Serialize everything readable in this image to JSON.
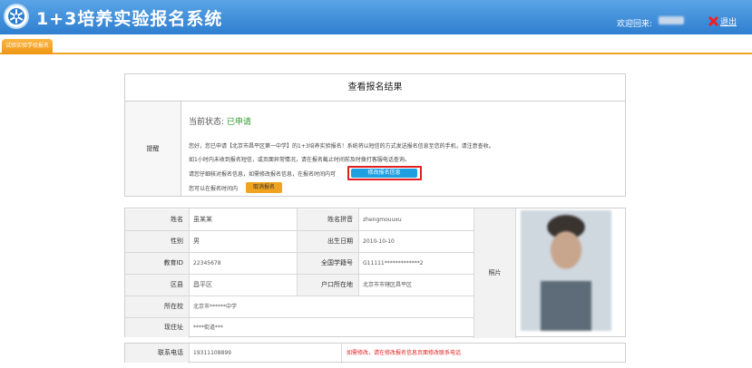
{
  "header": {
    "title": "1+3培养实验报名系统",
    "welcome": "欢迎回来:",
    "logout": "退出"
  },
  "tabs": [
    {
      "label": "试验实验学校报名"
    }
  ],
  "result": {
    "title": "查看报名结果",
    "hint_label": "提醒",
    "status_prefix": "当前状态:",
    "status_value": "已申请",
    "lines": [
      "您好，您已申请【北京市昌平区第一中学】的1+3培养实验报名！系统将以短信的方式发送报名信息至您的手机，请注意查收。",
      "如1小时内未收到报名短信，或页面异常情况，请在报名截止时间前及时拨打客服电话查询。",
      "请您仔细核对报名信息，如需修改报名信息，在报名时间内可",
      "您可以在报名时间内"
    ],
    "modify_button": "修改报名信息",
    "cancel_button": "取消报名"
  },
  "info": {
    "rows": [
      {
        "label": "姓名",
        "value": "虽某某",
        "label2": "姓名拼音",
        "value2": "zhengmouuxu"
      },
      {
        "label": "性别",
        "value": "男",
        "label2": "出生日期",
        "value2": "2010-10-10"
      },
      {
        "label": "教育ID",
        "value": "22345678",
        "label2": "全国学籍号",
        "value2": "G11111*************2"
      },
      {
        "label": "区县",
        "value": "昌平区",
        "label2": "户口所在地",
        "value2": "北京市市辖区昌平区"
      },
      {
        "label": "所在校",
        "value": "北京市******中学"
      },
      {
        "label": "现住址",
        "value": "****街道***"
      }
    ],
    "photo_label": "照片"
  },
  "contact": {
    "label": "联系电话",
    "value": "19311108899",
    "note": "如需修改，请在修改报名信息页面修改联系电话"
  },
  "colors": {
    "header": "#2f7fd0",
    "tab": "#f2a322",
    "status": "#2d9b2d",
    "button": "#1e9fe0",
    "highlight": "#e02020"
  }
}
